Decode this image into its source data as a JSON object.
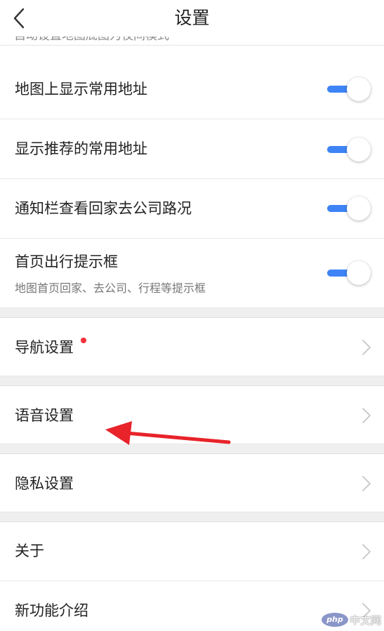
{
  "header": {
    "title": "设置",
    "back_icon": "chevron-left-icon"
  },
  "partial_row": {
    "label": "自动设置地图底图为夜间模式"
  },
  "toggles": [
    {
      "label": "地图上显示常用地址",
      "on": true
    },
    {
      "label": "显示推荐的常用地址",
      "on": true
    },
    {
      "label": "通知栏查看回家去公司路况",
      "on": true
    },
    {
      "label": "首页出行提示框",
      "sub": "地图首页回家、去公司、行程等提示框",
      "on": true
    }
  ],
  "nav": {
    "label": "导航设置",
    "badge": "red-dot"
  },
  "voice": {
    "label": "语音设置"
  },
  "privacy": {
    "label": "隐私设置"
  },
  "about": {
    "label": "关于"
  },
  "features": {
    "label": "新功能介绍"
  },
  "watermark": {
    "logo": "php",
    "text": "中文网"
  },
  "colors": {
    "accent": "#3f84f6",
    "badge": "#f2313a",
    "annotation_arrow": "#e8232a",
    "section_gap": "#efefef"
  }
}
